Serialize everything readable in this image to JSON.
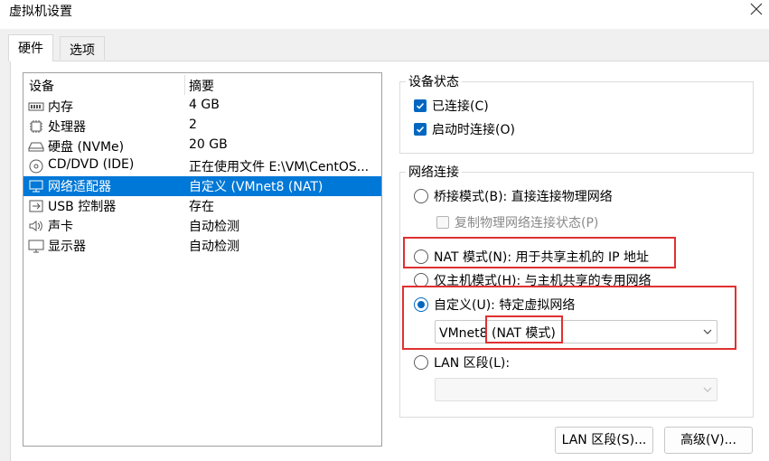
{
  "window": {
    "title": "虚拟机设置"
  },
  "tabs": [
    {
      "label": "硬件"
    },
    {
      "label": "选项"
    }
  ],
  "device_list": {
    "headers": {
      "device": "设备",
      "summary": "摘要"
    },
    "rows": [
      {
        "name": "内存",
        "summary": "4 GB",
        "icon": "memory-icon"
      },
      {
        "name": "处理器",
        "summary": "2",
        "icon": "cpu-icon"
      },
      {
        "name": "硬盘 (NVMe)",
        "summary": "20 GB",
        "icon": "harddisk-icon"
      },
      {
        "name": "CD/DVD (IDE)",
        "summary": "正在使用文件 E:\\VM\\CentOS...",
        "icon": "cd-dvd-icon"
      },
      {
        "name": "网络适配器",
        "summary": "自定义 (VMnet8 (NAT)",
        "icon": "network-adapter-icon",
        "selected": true
      },
      {
        "name": "USB 控制器",
        "summary": "存在",
        "icon": "usb-icon"
      },
      {
        "name": "声卡",
        "summary": "自动检测",
        "icon": "speaker-icon"
      },
      {
        "name": "显示器",
        "summary": "自动检测",
        "icon": "monitor-icon"
      }
    ]
  },
  "device_status": {
    "legend": "设备状态",
    "connected": {
      "label": "已连接(C)",
      "checked": true
    },
    "connect_at_power_on": {
      "label": "启动时连接(O)",
      "checked": true
    }
  },
  "network_connection": {
    "legend": "网络连接",
    "bridged": {
      "label": "桥接模式(B): 直接连接物理网络",
      "selected": false
    },
    "replicate": {
      "label": "复制物理网络连接状态(P)",
      "checked": false,
      "enabled": false
    },
    "nat": {
      "label": "NAT 模式(N): 用于共享主机的 IP 地址",
      "selected": false
    },
    "host_only": {
      "label": "仅主机模式(H): 与主机共享的专用网络",
      "selected": false
    },
    "custom": {
      "label": "自定义(U): 特定虚拟网络",
      "selected": true
    },
    "custom_select": {
      "value_prefix": "VMnet8",
      "value_suffix": "(NAT 模式)"
    },
    "lan_segment": {
      "label": "LAN 区段(L):",
      "selected": false
    },
    "lan_select": {
      "value": ""
    }
  },
  "buttons": {
    "lan_segments": "LAN 区段(S)...",
    "advanced": "高级(V)..."
  },
  "colors": {
    "accent": "#0067c0",
    "selection": "#0078d7",
    "highlight_box": "#e03030"
  }
}
